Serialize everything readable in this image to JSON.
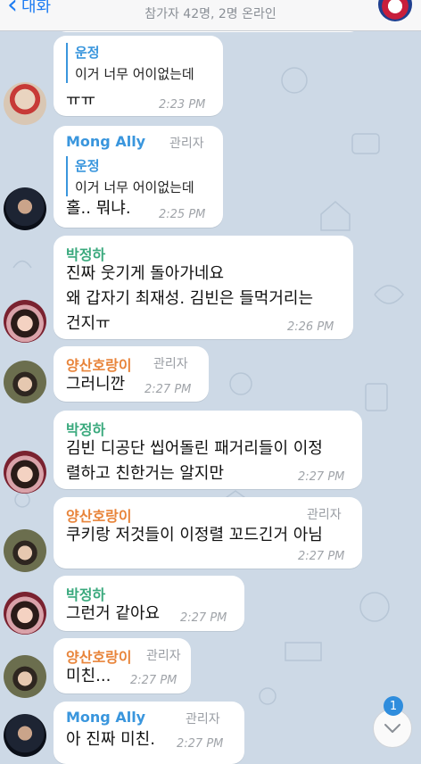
{
  "header": {
    "back_label": "대화",
    "subtitle": "참가자 42명, 2명 온라인"
  },
  "colors": {
    "background": "#cdd9e6",
    "accent": "#1e7cf2",
    "name_mong": "#3a96dd",
    "name_park": "#3aa97d",
    "name_yang": "#e8843a",
    "reply_bar": "#3a96dd",
    "badge": "#2f8ddd"
  },
  "messages": [
    {
      "reply_name": "운정",
      "reply_text": "이거 너무 어이없는데",
      "text": "ㅠㅠ",
      "time": "2:23 PM"
    },
    {
      "sender": "Mong Ally",
      "role": "관리자",
      "reply_name": "운정",
      "reply_text": "이거 너무 어이없는데",
      "text": "홀.. 뭐냐.",
      "time": "2:25 PM"
    },
    {
      "sender": "박정하",
      "lines": [
        "진짜 웃기게 돌아가네요",
        "왜 갑자기 최재성. 김빈은 들먹거리는",
        "건지ㅠ"
      ],
      "time": "2:26 PM"
    },
    {
      "sender": "양산호랑이",
      "role": "관리자",
      "text": "그러니깐",
      "time": "2:27 PM"
    },
    {
      "sender": "박정하",
      "lines": [
        "김빈 디공단 씹어돌린 패거리들이 이정",
        "렬하고 친한거는 알지만"
      ],
      "time": "2:27 PM"
    },
    {
      "sender": "양산호랑이",
      "role": "관리자",
      "text": "쿠키랑 저것들이 이정렬 꼬드긴거 아님",
      "time": "2:27 PM"
    },
    {
      "sender": "박정하",
      "text": "그런거 같아요",
      "time": "2:27 PM"
    },
    {
      "sender": "양산호랑이",
      "role": "관리자",
      "text": "미친...",
      "time": "2:27 PM"
    },
    {
      "sender": "Mong Ally",
      "role": "관리자",
      "text": "아 진짜 미친.",
      "time": "2:27 PM"
    }
  ],
  "unread_badge": "1",
  "icons": {
    "back": "chevron-left-icon",
    "scroll_down": "chevron-down-icon"
  }
}
